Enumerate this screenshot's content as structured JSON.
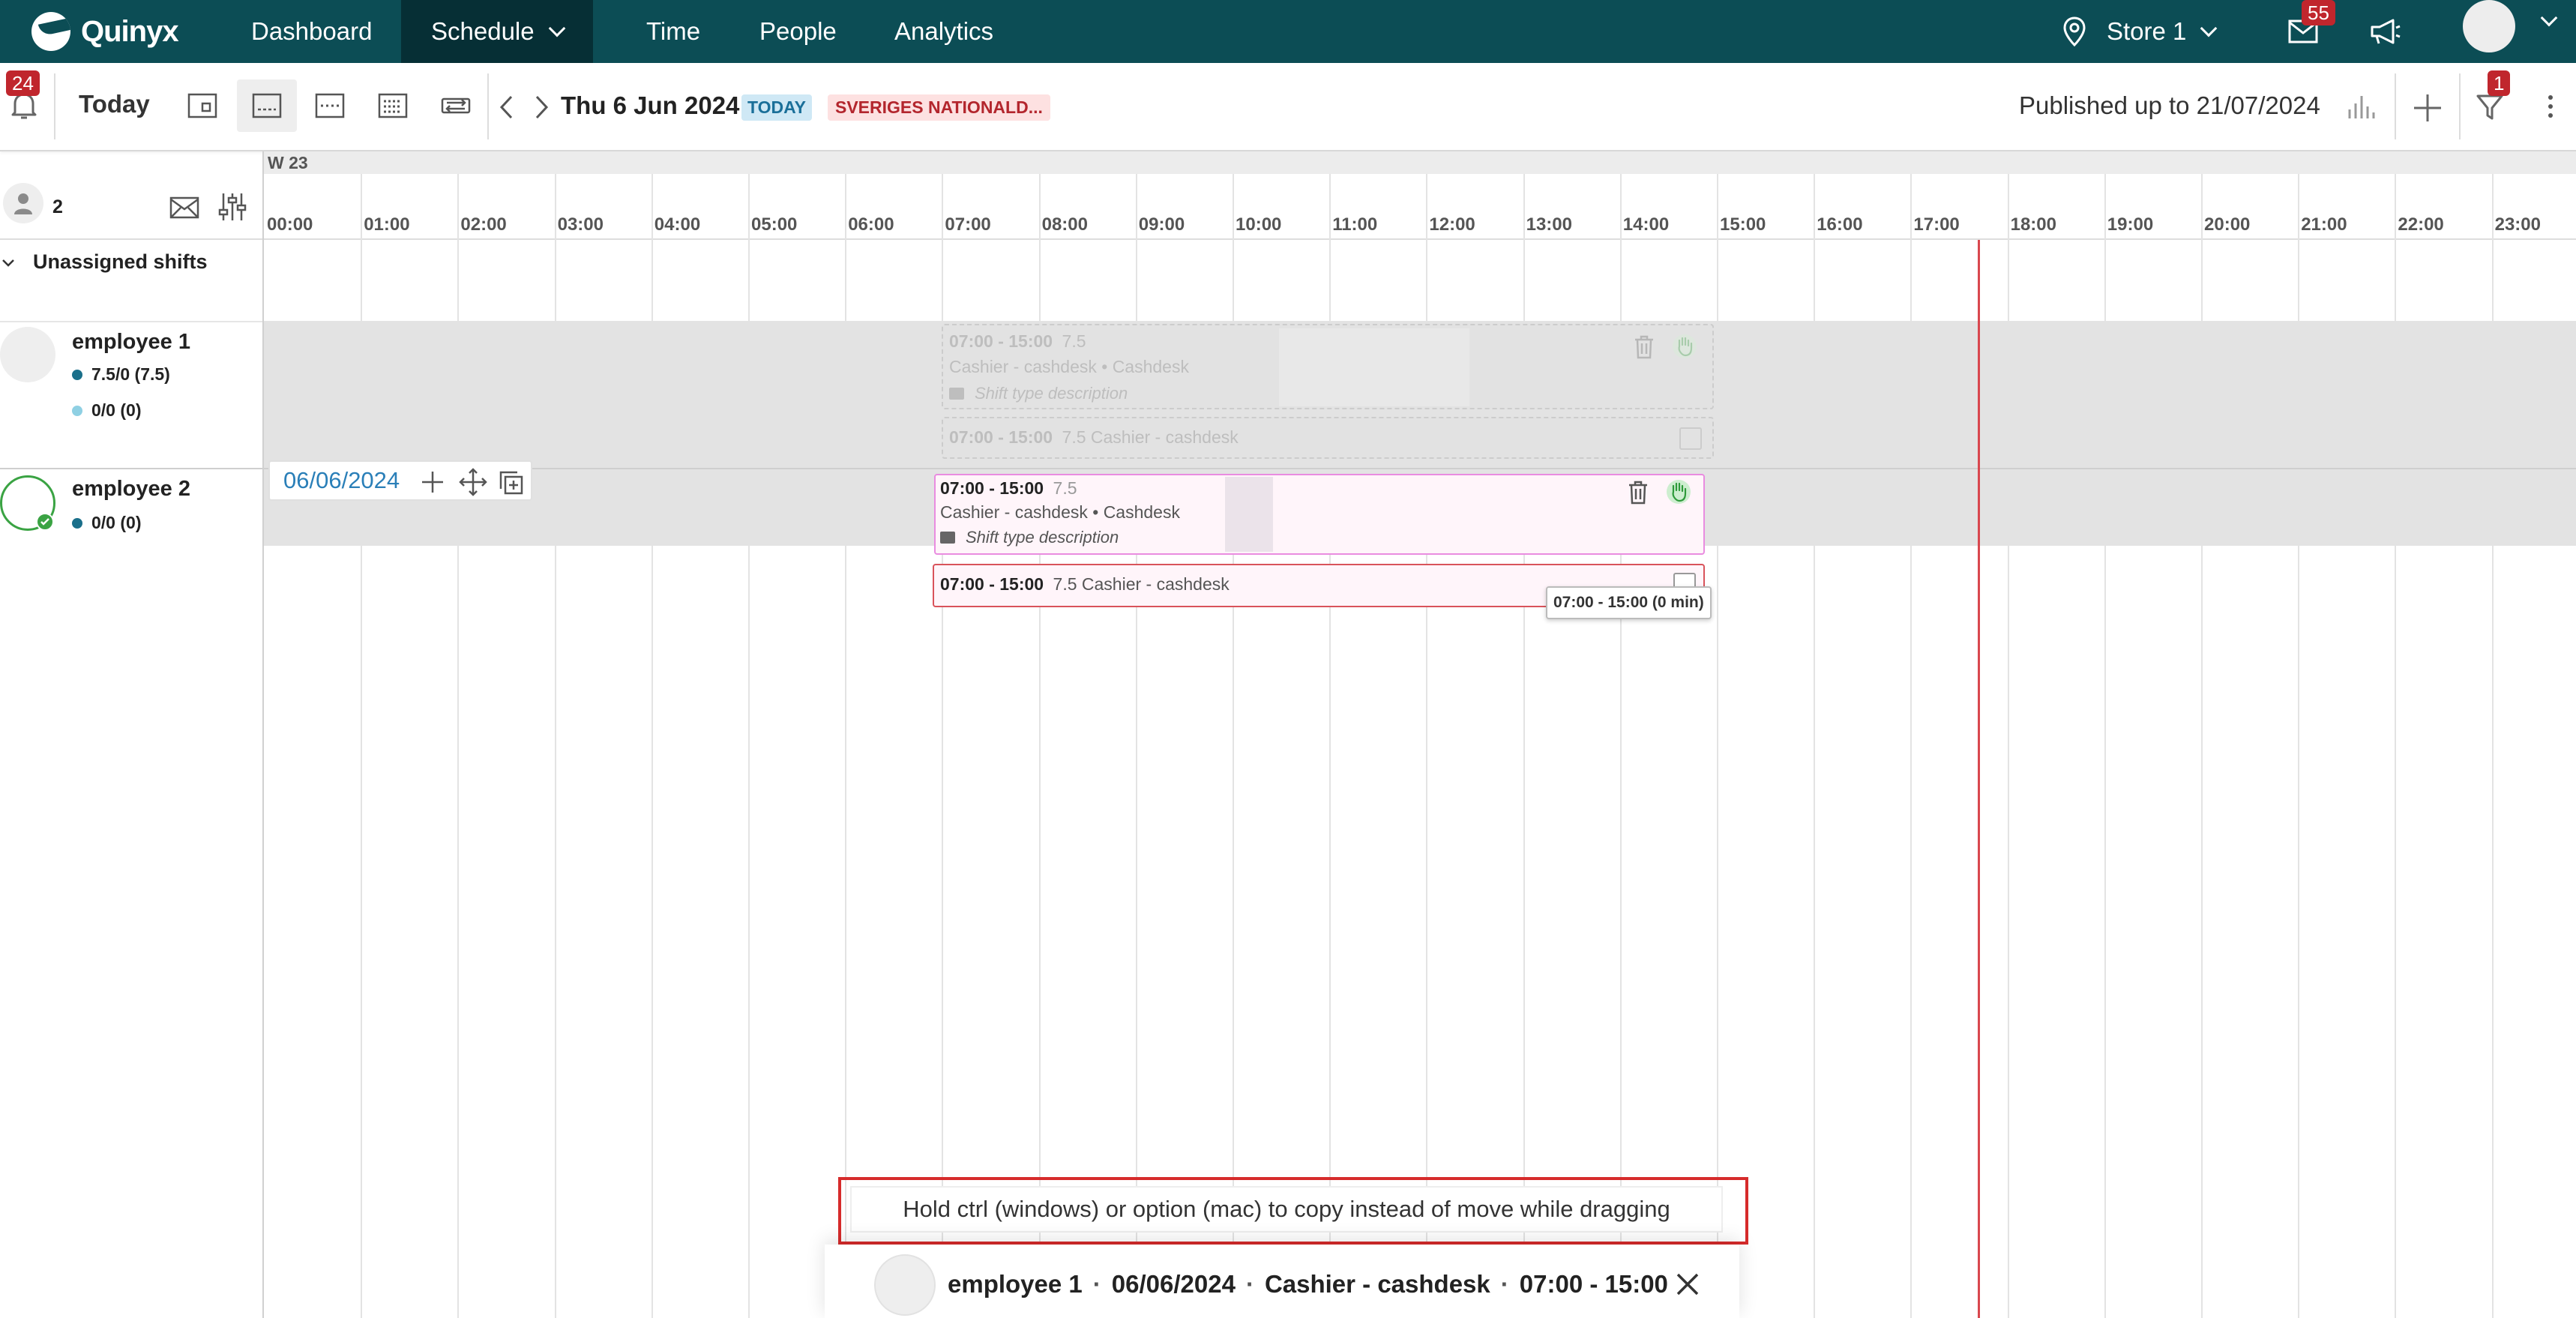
{
  "app": {
    "logo_text": "Quinyx",
    "brand_color": "#0c4d55",
    "accent_color": "#2a7fb8"
  },
  "nav": {
    "items": [
      {
        "label": "Dashboard"
      },
      {
        "label": "Schedule",
        "active": true
      },
      {
        "label": "Time"
      },
      {
        "label": "People"
      },
      {
        "label": "Analytics"
      }
    ],
    "store": "Store 1",
    "messages_count": "55"
  },
  "toolbar": {
    "notifications_count": "24",
    "today_label": "Today",
    "date": "Thu 6 Jun 2024",
    "today_tag": "TODAY",
    "holiday_tag": "SVERIGES NATIONALD...",
    "published": "Published up to 21/07/2024",
    "filter_count": "1"
  },
  "grid": {
    "week": "W 23",
    "hours": [
      "00:00",
      "01:00",
      "02:00",
      "03:00",
      "04:00",
      "05:00",
      "06:00",
      "07:00",
      "08:00",
      "09:00",
      "10:00",
      "11:00",
      "12:00",
      "13:00",
      "14:00",
      "15:00",
      "16:00",
      "17:00",
      "18:00",
      "19:00",
      "20:00",
      "21:00",
      "22:00",
      "23:00"
    ]
  },
  "sidebar": {
    "employee_count": "2",
    "unassigned_label": "Unassigned shifts",
    "employees": [
      {
        "name": "employee 1",
        "stats": [
          "7.5/0 (7.5)",
          "0/0 (0)"
        ]
      },
      {
        "name": "employee 2",
        "stats": [
          "0/0 (0)"
        ]
      }
    ]
  },
  "shifts": {
    "ghost": {
      "time": "07:00 - 15:00",
      "hours": "7.5",
      "role": "Cashier - cashdesk • Cashdesk",
      "desc": "Shift type description",
      "sub_time": "07:00 - 15:00",
      "sub_text": "7.5 Cashier - cashdesk"
    },
    "live": {
      "time": "07:00 - 15:00",
      "hours": "7.5",
      "role": "Cashier - cashdesk • Cashdesk",
      "desc": "Shift type description",
      "sub_time": "07:00 - 15:00",
      "sub_text": "7.5 Cashier - cashdesk"
    },
    "tooltip": "07:00 - 15:00 (0 min)"
  },
  "drag_chip": {
    "date": "06/06/2024"
  },
  "bottom": {
    "hint": "Hold ctrl (windows) or option (mac) to copy instead of move while dragging",
    "drag_info": {
      "employee": "employee 1",
      "date": "06/06/2024",
      "role": "Cashier - cashdesk",
      "time": "07:00 - 15:00",
      "separator": "·"
    }
  }
}
